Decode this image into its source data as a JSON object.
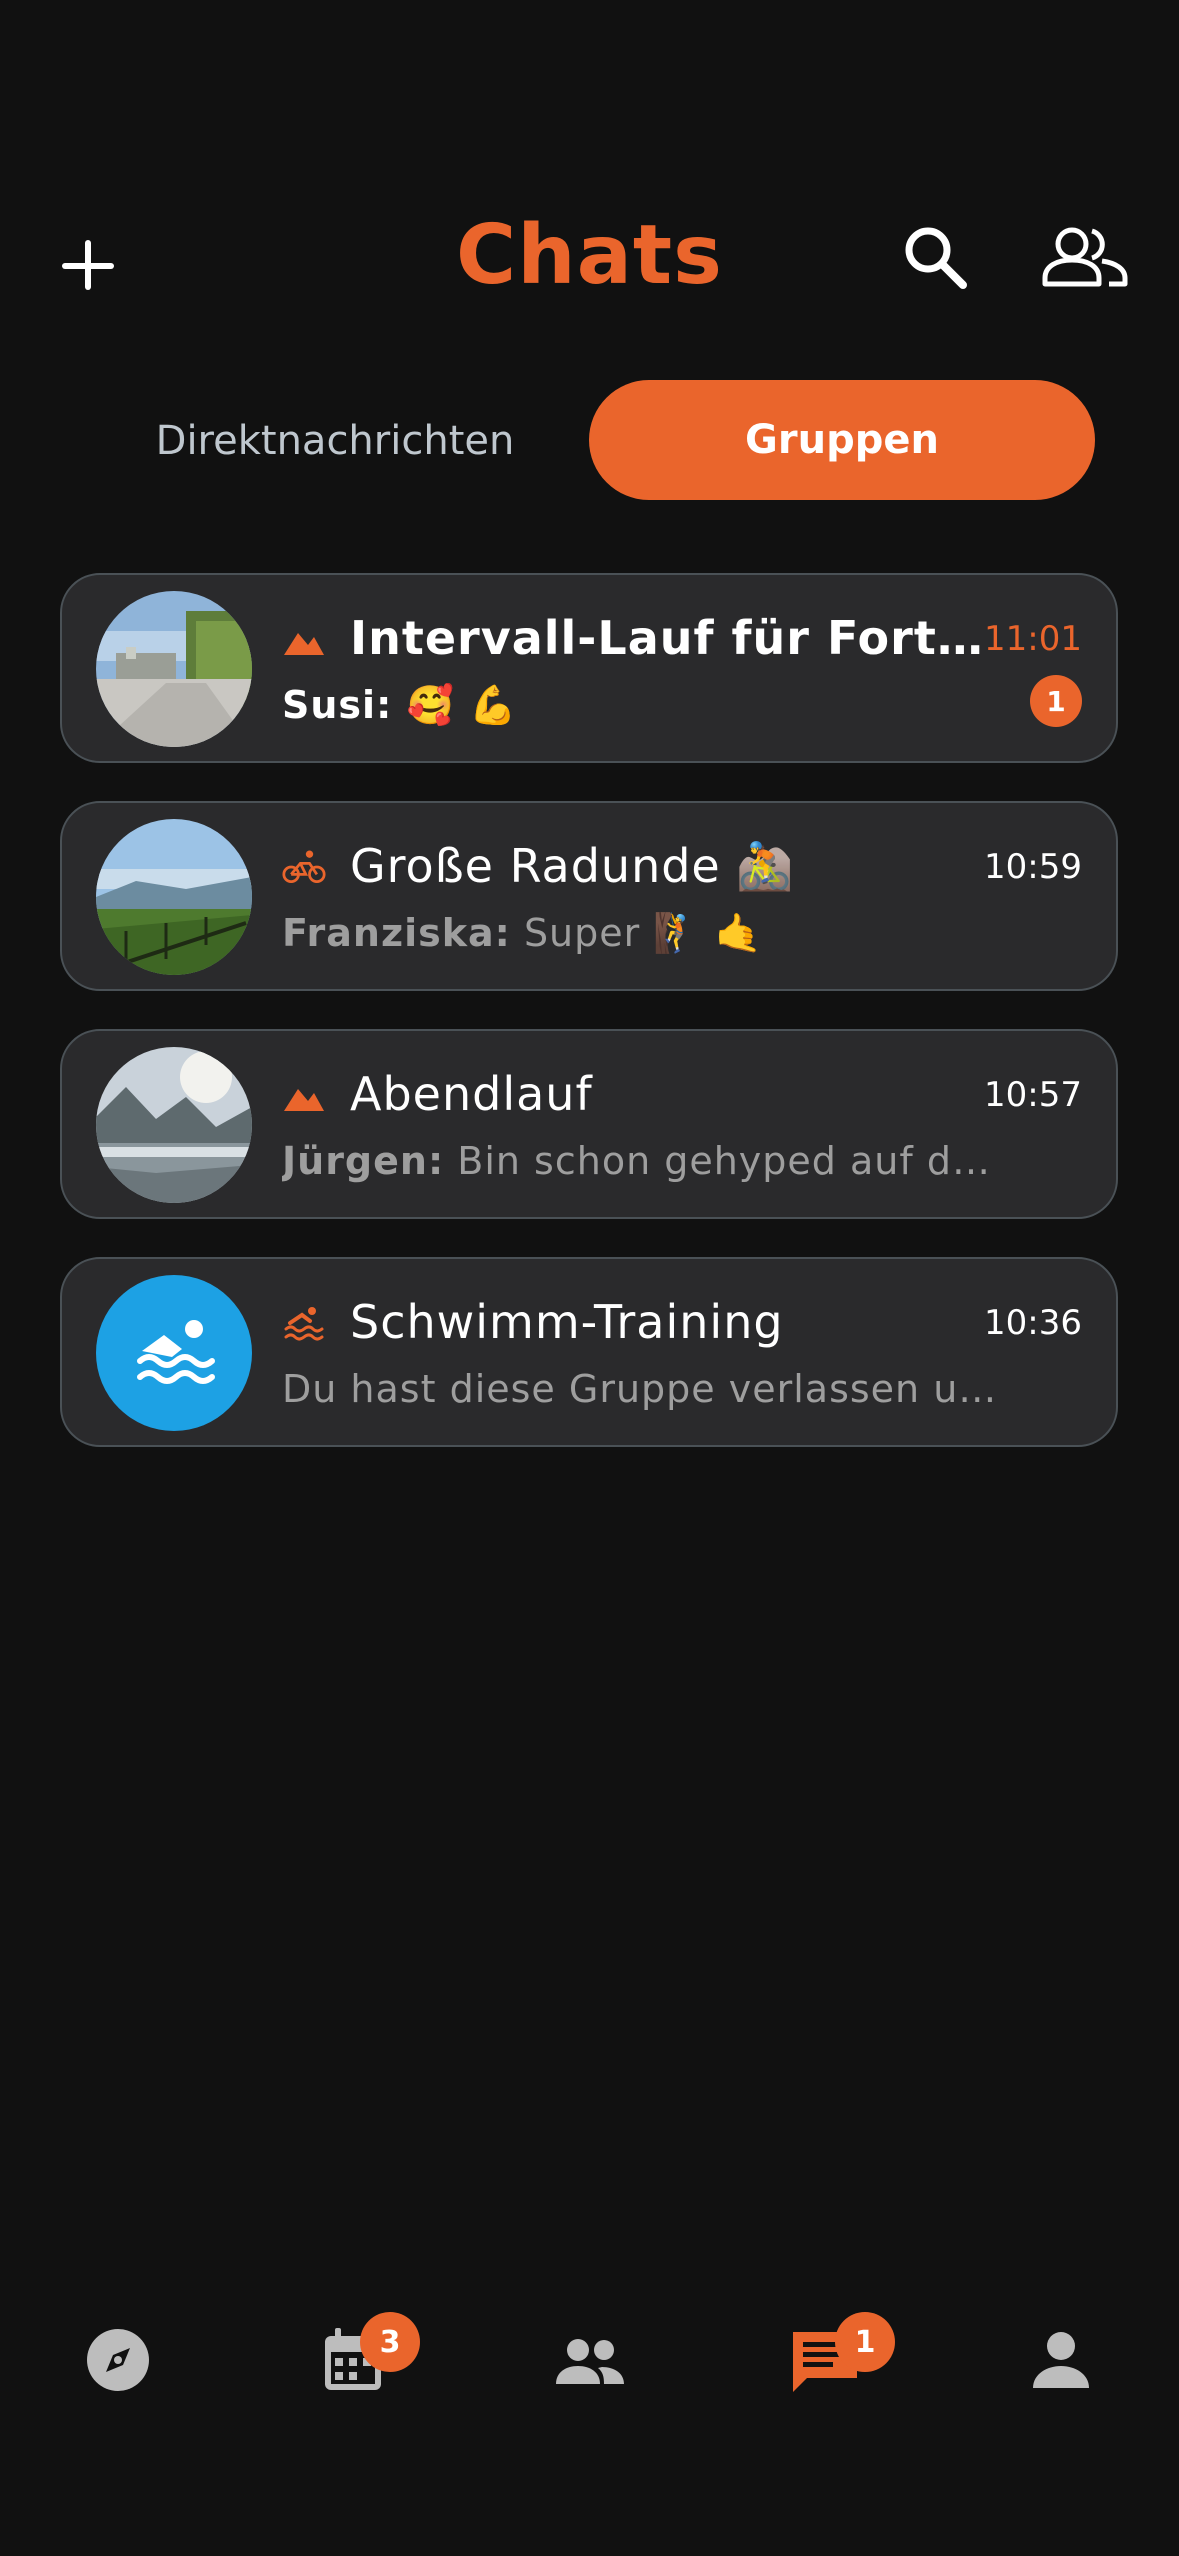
{
  "header": {
    "title": "Chats",
    "add_icon": "plus-icon",
    "search_icon": "search-icon",
    "people_icon": "people-icon"
  },
  "tabs": {
    "direct": "Direktnachrichten",
    "groups": "Gruppen",
    "active": "groups"
  },
  "colors": {
    "accent": "#EA652C",
    "background": "#111111",
    "card": "#2A2A2C",
    "card_border": "#4A5156",
    "muted_text": "#9E9E9E",
    "swim_avatar": "#1DA1E4"
  },
  "chats": [
    {
      "name": "Intervall-Lauf für Fortgeschrittene",
      "sport_icon": "running-terrain-icon",
      "time": "11:01",
      "sender": "Susi:",
      "message": "🥰 💪",
      "unread_count": "1",
      "unread": true
    },
    {
      "name": "Große Radunde 🚵",
      "sport_icon": "bicycle-icon",
      "time": "10:59",
      "sender": "Franziska:",
      "message": "Super 🧗 🤙",
      "unread": false
    },
    {
      "name": "Abendlauf",
      "sport_icon": "running-terrain-icon",
      "time": "10:57",
      "sender": "Jürgen:",
      "message": "Bin schon gehyped auf den Lauf heute Abend",
      "unread": false
    },
    {
      "name": "Schwimm-Training",
      "sport_icon": "swimming-icon",
      "time": "10:36",
      "sender": "",
      "message": "Du hast diese Gruppe verlassen und erhältst keine Nachrichten mehr",
      "unread": false
    }
  ],
  "bottom_nav": [
    {
      "icon": "compass-icon",
      "badge": ""
    },
    {
      "icon": "calendar-icon",
      "badge": "3"
    },
    {
      "icon": "group-icon",
      "badge": ""
    },
    {
      "icon": "chat-icon",
      "badge": "1",
      "active": true
    },
    {
      "icon": "profile-icon",
      "badge": ""
    }
  ]
}
